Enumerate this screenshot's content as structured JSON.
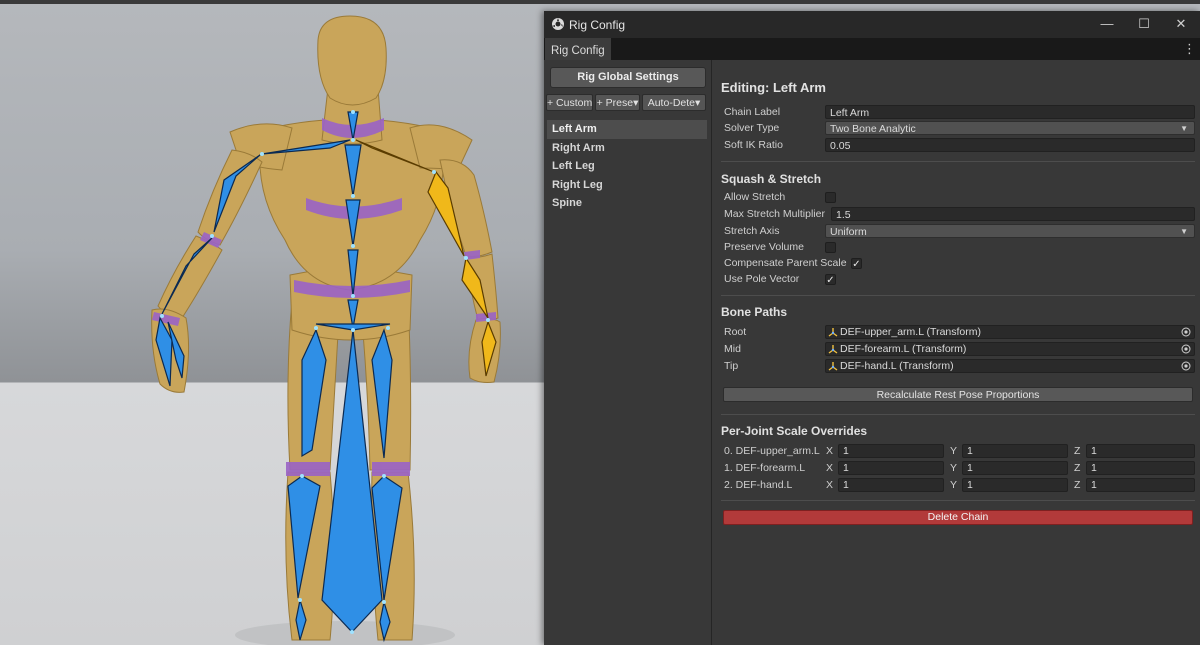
{
  "window": {
    "title": "Rig Config",
    "tab": "Rig Config",
    "controls": {
      "minimize": "—",
      "maximize": "☐",
      "close": "✕"
    },
    "menu_glyph": "⋮"
  },
  "left_panel": {
    "global_button": "Rig Global Settings",
    "toolbar": [
      {
        "label": "+ Custom"
      },
      {
        "label": "+ Prese▾"
      },
      {
        "label": "Auto-Dete▾"
      }
    ],
    "chains": [
      "Left Arm",
      "Right Arm",
      "Left Leg",
      "Right Leg",
      "Spine"
    ],
    "selected_chain": "Left Arm"
  },
  "editor": {
    "heading": "Editing: Left Arm",
    "chain_label": {
      "label": "Chain Label",
      "value": "Left Arm"
    },
    "solver_type": {
      "label": "Solver Type",
      "value": "Two Bone Analytic"
    },
    "soft_ik": {
      "label": "Soft IK Ratio",
      "value": "0.05"
    },
    "squash_stretch": {
      "heading": "Squash & Stretch",
      "allow_stretch": {
        "label": "Allow Stretch",
        "checked": false
      },
      "max_stretch": {
        "label": "Max Stretch Multiplier",
        "value": "1.5"
      },
      "stretch_axis": {
        "label": "Stretch Axis",
        "value": "Uniform"
      },
      "preserve_volume": {
        "label": "Preserve Volume",
        "checked": false
      },
      "compensate_parent": {
        "label": "Compensate Parent Scale",
        "checked": true
      },
      "use_pole_vector": {
        "label": "Use Pole Vector",
        "checked": true
      }
    },
    "bone_paths": {
      "heading": "Bone Paths",
      "rows": [
        {
          "label": "Root",
          "value": "DEF-upper_arm.L (Transform)"
        },
        {
          "label": "Mid",
          "value": "DEF-forearm.L (Transform)"
        },
        {
          "label": "Tip",
          "value": "DEF-hand.L (Transform)"
        }
      ],
      "recalc_button": "Recalculate Rest Pose Proportions"
    },
    "scale_overrides": {
      "heading": "Per-Joint Scale Overrides",
      "axes": [
        "X",
        "Y",
        "Z"
      ],
      "rows": [
        {
          "label": "0. DEF-upper_arm.L",
          "x": "1",
          "y": "1",
          "z": "1"
        },
        {
          "label": "1. DEF-forearm.L",
          "x": "1",
          "y": "1",
          "z": "1"
        },
        {
          "label": "2. DEF-hand.L",
          "x": "1",
          "y": "1",
          "z": "1"
        }
      ]
    },
    "delete_button": "Delete Chain"
  },
  "colors": {
    "accent_bone": "#2f8fe6",
    "selected_bone": "#f0b81a",
    "delete": "#b23a3a",
    "mannequin": "#c9a55a",
    "joint_band": "#9a63c6"
  }
}
